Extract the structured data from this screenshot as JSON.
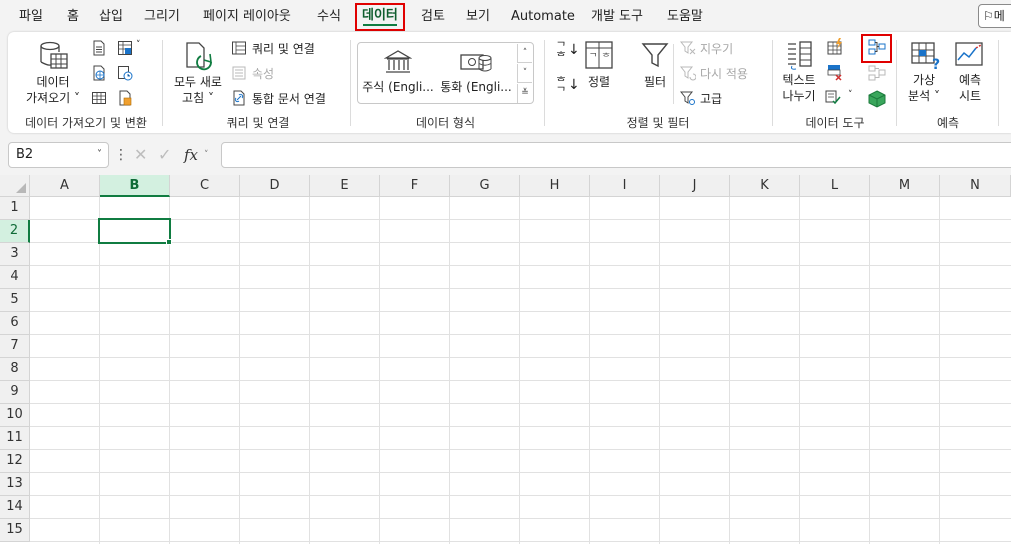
{
  "menu": {
    "tabs": [
      "파일",
      "홈",
      "삽입",
      "그리기",
      "페이지 레이아웃",
      "수식",
      "데이터",
      "검토",
      "보기",
      "Automate",
      "개발 도구",
      "도움말"
    ],
    "active_tab": "데이터",
    "share_label": "메"
  },
  "ribbon": {
    "get_data": {
      "get_data_line1": "데이터",
      "get_data_line2": "가져오기 ˅",
      "group_label": "데이터 가져오기 및 변환"
    },
    "queries": {
      "refresh_line1": "모두 새로",
      "refresh_line2": "고침 ˅",
      "queries_connections": "쿼리 및 연결",
      "properties": "속성",
      "workbook_links": "통합 문서 연결",
      "group_label": "쿼리 및 연결"
    },
    "data_types": {
      "stocks": "주식 (Engli...",
      "currencies": "통화 (Engli...",
      "group_label": "데이터 형식"
    },
    "sort_filter": {
      "sort": "정렬",
      "filter": "필터",
      "clear": "지우기",
      "reapply": "다시 적용",
      "advanced": "고급",
      "group_label": "정렬 및 필터"
    },
    "data_tools": {
      "text_to_columns_line1": "텍스트",
      "text_to_columns_line2": "나누기",
      "group_label": "데이터 도구"
    },
    "forecast": {
      "what_if_line1": "가상",
      "what_if_line2": "분석 ˅",
      "forecast_sheet_line1": "예측",
      "forecast_sheet_line2": "시트",
      "group_label": "예측"
    }
  },
  "formula_bar": {
    "name_box": "B2",
    "fx": "fx",
    "formula": ""
  },
  "sheet": {
    "columns": [
      "A",
      "B",
      "C",
      "D",
      "E",
      "F",
      "G",
      "H",
      "I",
      "J",
      "K",
      "L",
      "M",
      "N"
    ],
    "rows": [
      "1",
      "2",
      "3",
      "4",
      "5",
      "6",
      "7",
      "8",
      "9",
      "10",
      "11",
      "12",
      "13",
      "14",
      "15"
    ],
    "selected_column": "B",
    "selected_row": "2"
  },
  "colors": {
    "accent": "#107c41",
    "highlight_box": "#e00000",
    "selected_header_bg": "#d3f0e0"
  }
}
